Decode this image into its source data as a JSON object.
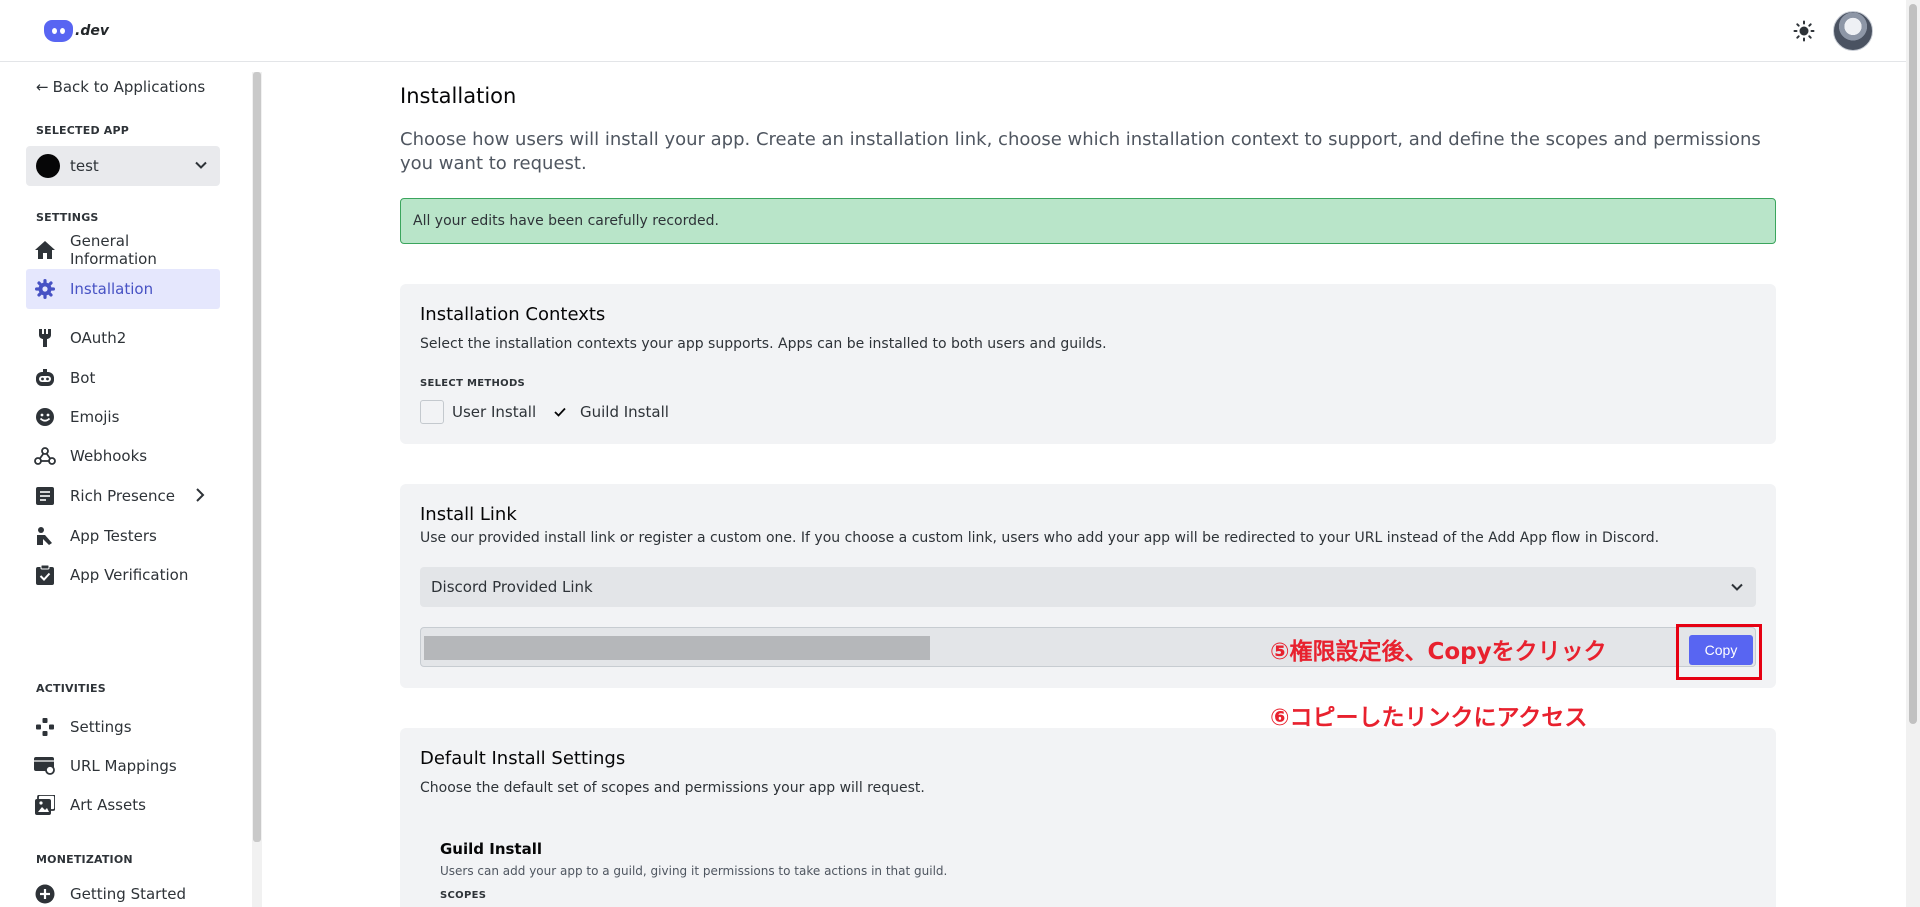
{
  "header": {
    "logo_text": ".dev",
    "theme_icon": "sun-icon",
    "avatar_icon": "user-avatar"
  },
  "sidebar": {
    "back_label": "Back to Applications",
    "selected_app_label": "SELECTED APP",
    "app_name": "test",
    "settings_label": "SETTINGS",
    "activities_label": "ACTIVITIES",
    "monetization_label": "MONETIZATION",
    "items": [
      {
        "label": "General Information",
        "icon": "home-icon"
      },
      {
        "label": "Installation",
        "icon": "gear-icon",
        "active": true
      },
      {
        "label": "OAuth2",
        "icon": "wrench-icon"
      },
      {
        "label": "Bot",
        "icon": "robot-icon"
      },
      {
        "label": "Emojis",
        "icon": "smiley-icon"
      },
      {
        "label": "Webhooks",
        "icon": "webhook-icon"
      },
      {
        "label": "Rich Presence",
        "icon": "document-icon"
      },
      {
        "label": "App Testers",
        "icon": "tester-icon"
      },
      {
        "label": "App Verification",
        "icon": "clipboard-check-icon"
      }
    ],
    "activity_items": [
      {
        "label": "Settings",
        "icon": "controller-icon"
      },
      {
        "label": "URL Mappings",
        "icon": "url-map-icon"
      },
      {
        "label": "Art Assets",
        "icon": "image-icon"
      }
    ],
    "monetization_items": [
      {
        "label": "Getting Started",
        "icon": "plus-circle-icon"
      }
    ]
  },
  "main": {
    "title": "Installation",
    "description": "Choose how users will install your app. Create an installation link, choose which installation context to support, and define the scopes and permissions you want to request.",
    "banner": "All your edits have been carefully recorded.",
    "contexts": {
      "title": "Installation Contexts",
      "description": "Select the installation contexts your app supports. Apps can be installed to both users and guilds.",
      "methods_label": "SELECT METHODS",
      "user_install": "User Install",
      "user_install_checked": false,
      "guild_install": "Guild Install",
      "guild_install_checked": true
    },
    "install_link": {
      "title": "Install Link",
      "description": "Use our provided install link or register a custom one. If you choose a custom link, users who add your app will be redirected to your URL instead of the Add App flow in Discord.",
      "select_value": "Discord Provided Link",
      "copy_label": "Copy"
    },
    "annotations": {
      "step5": "⑤権限設定後、Copyをクリック",
      "step6": "⑥コピーしたリンクにアクセス"
    },
    "default_settings": {
      "title": "Default Install Settings",
      "description": "Choose the default set of scopes and permissions your app will request.",
      "guild_install_title": "Guild Install",
      "guild_install_desc": "Users can add your app to a guild, giving it permissions to take actions in that guild.",
      "scopes_label": "SCOPES"
    }
  },
  "colors": {
    "accent": "#5865f2",
    "banner_bg": "#b9e5c9",
    "banner_border": "#3ba55d",
    "annotation_red": "#e8212e"
  }
}
